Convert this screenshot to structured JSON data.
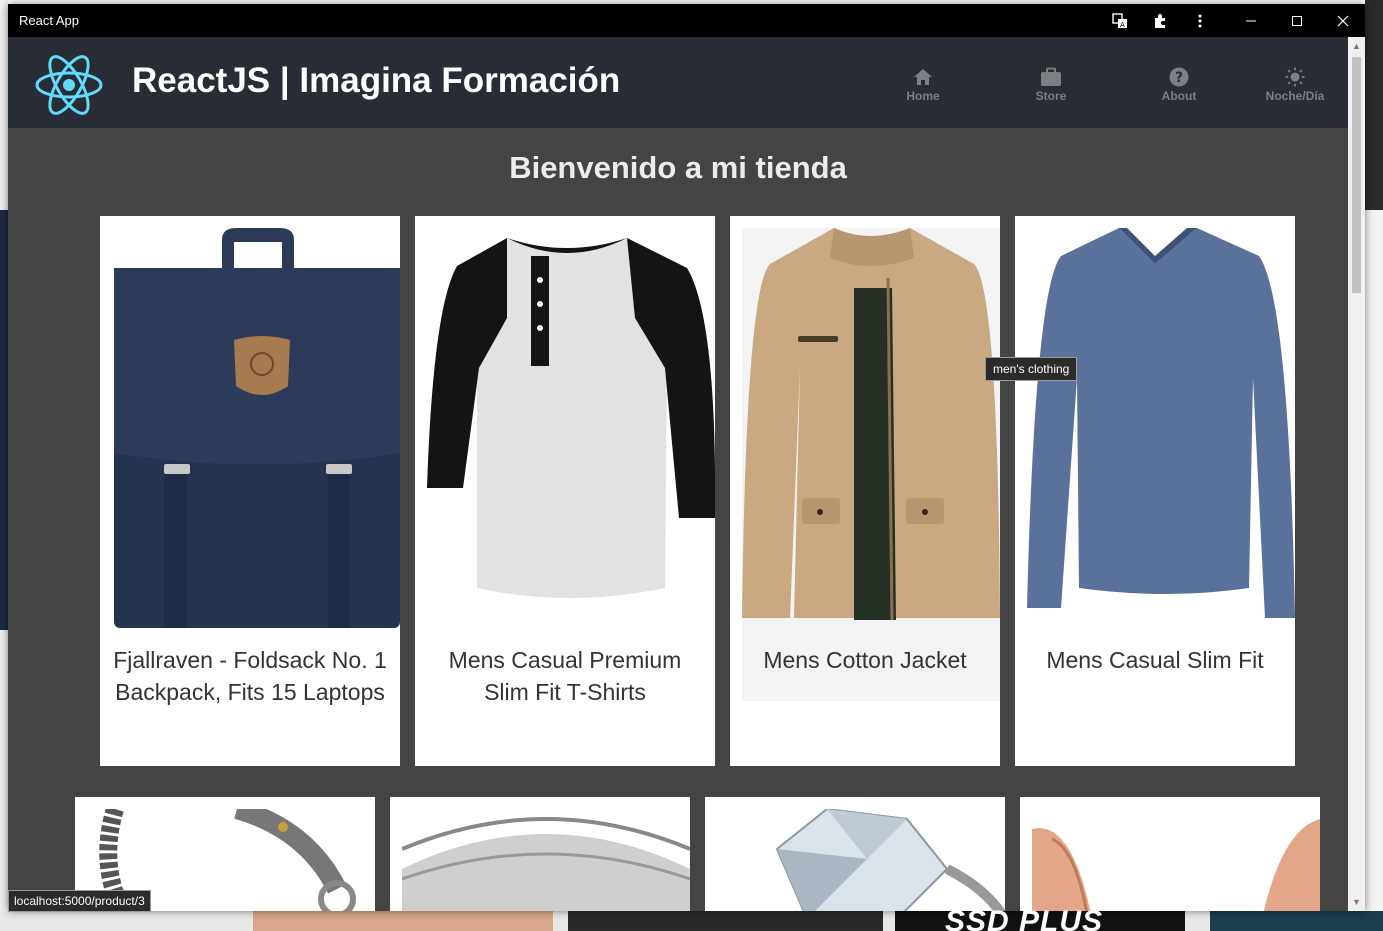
{
  "window": {
    "title": "React App"
  },
  "header": {
    "brand": "ReactJS | Imagina Formación",
    "nav": [
      {
        "label": "Home",
        "icon": "home-icon"
      },
      {
        "label": "Store",
        "icon": "briefcase-icon"
      },
      {
        "label": "About",
        "icon": "help-icon"
      },
      {
        "label": "Noche/Día",
        "icon": "sun-icon"
      }
    ]
  },
  "main": {
    "heading": "Bienvenido a mi tienda",
    "products": [
      {
        "name": "Fjallraven - Foldsack No. 1 Backpack, Fits 15 Laptops",
        "image": "backpack"
      },
      {
        "name": "Mens Casual Premium Slim Fit T-Shirts",
        "image": "raglan-tshirt"
      },
      {
        "name": "Mens Cotton Jacket",
        "image": "cotton-jacket"
      },
      {
        "name": "Mens Casual Slim Fit",
        "image": "long-sleeve-shirt"
      }
    ],
    "products_row2": [
      {
        "image": "dragon-bracelet"
      },
      {
        "image": "silver-ring"
      },
      {
        "image": "diamond-ring"
      },
      {
        "image": "rose-gold-ring"
      }
    ]
  },
  "tooltip": "men's clothing",
  "statusbar": "localhost:5000/product/3",
  "colors": {
    "header_bg": "#282c34",
    "page_bg": "#444444",
    "react_blue": "#61dafb",
    "nav_text": "#7d7f83"
  }
}
